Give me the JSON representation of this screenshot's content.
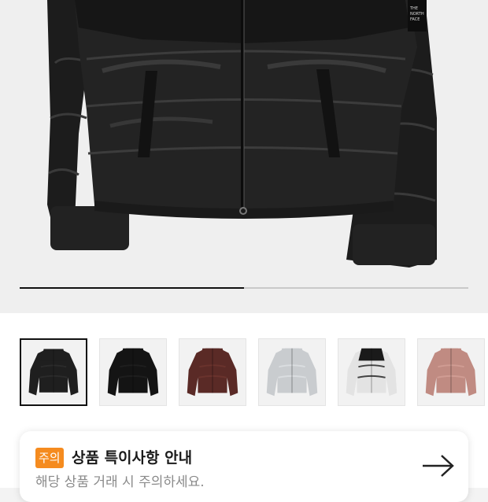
{
  "product": {
    "image_count": 2,
    "current_image": 1,
    "carousel_progress_fraction": 0.5
  },
  "thumbnails": [
    {
      "name": "black-glossy",
      "color": "#1f1f1f",
      "accent": "#2e2e2e",
      "selected": true
    },
    {
      "name": "black-matte",
      "color": "#141414",
      "accent": "#202020",
      "selected": false
    },
    {
      "name": "brown",
      "color": "#5a2a26",
      "accent": "#6e3630",
      "selected": false
    },
    {
      "name": "silver",
      "color": "#c9cccf",
      "accent": "#dfe1e3",
      "selected": false
    },
    {
      "name": "white-black",
      "color": "#e3e3e3",
      "accent": "#1a1a1a",
      "selected": false
    },
    {
      "name": "pink",
      "color": "#c08b82",
      "accent": "#d3a097",
      "selected": false
    }
  ],
  "notice": {
    "badge": "주의",
    "title": "상품 특이사항 안내",
    "subtitle": "해당 상품 거래 시 주의하세요.",
    "arrow_icon": "arrow-right-icon"
  },
  "colors": {
    "badge": "#f58b1f",
    "progress": "#111111"
  }
}
